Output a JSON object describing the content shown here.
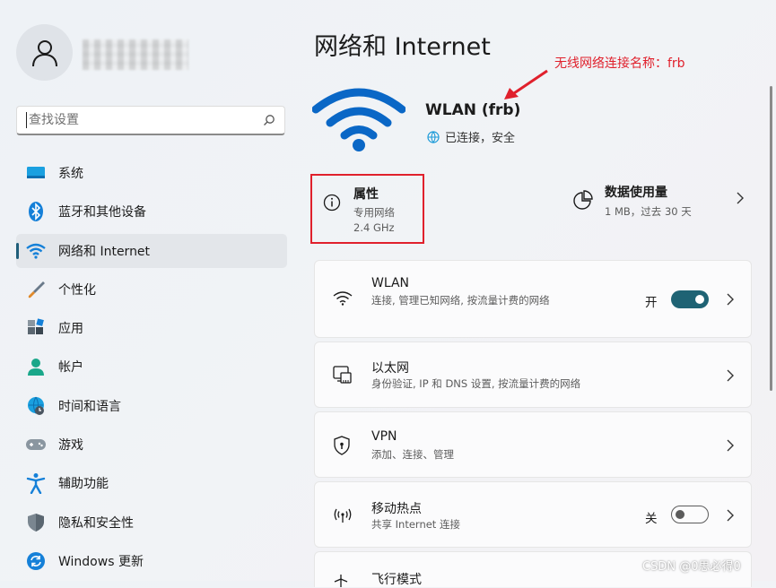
{
  "sidebar": {
    "search": {
      "placeholder": "查找设置"
    },
    "items": [
      {
        "label": "系统",
        "icon": "system-icon"
      },
      {
        "label": "蓝牙和其他设备",
        "icon": "bluetooth-icon"
      },
      {
        "label": "网络和 Internet",
        "icon": "wifi-icon",
        "active": true
      },
      {
        "label": "个性化",
        "icon": "brush-icon"
      },
      {
        "label": "应用",
        "icon": "apps-icon"
      },
      {
        "label": "帐户",
        "icon": "account-icon"
      },
      {
        "label": "时间和语言",
        "icon": "globe-clock-icon"
      },
      {
        "label": "游戏",
        "icon": "gamepad-icon"
      },
      {
        "label": "辅助功能",
        "icon": "accessibility-icon"
      },
      {
        "label": "隐私和安全性",
        "icon": "shield-icon"
      },
      {
        "label": "Windows 更新",
        "icon": "update-icon"
      }
    ]
  },
  "main": {
    "title": "网络和 Internet",
    "annotation": "无线网络连接名称：frb",
    "network": {
      "name": "WLAN (frb)",
      "status": "已连接，安全"
    },
    "properties": {
      "title": "属性",
      "type": "专用网络",
      "band": "2.4 GHz"
    },
    "data_usage": {
      "title": "数据使用量",
      "detail": "1 MB，过去 30 天"
    },
    "cards": [
      {
        "title": "WLAN",
        "subtitle": "连接, 管理已知网络, 按流量计费的网络",
        "toggle_label": "开",
        "toggle_on": true,
        "icon": "wifi-icon"
      },
      {
        "title": "以太网",
        "subtitle": "身份验证, IP 和 DNS 设置, 按流量计费的网络",
        "icon": "ethernet-icon"
      },
      {
        "title": "VPN",
        "subtitle": "添加、连接、管理",
        "icon": "vpn-shield-icon"
      },
      {
        "title": "移动热点",
        "subtitle": "共享 Internet 连接",
        "toggle_label": "关",
        "toggle_on": false,
        "icon": "hotspot-icon"
      },
      {
        "title": "飞行模式",
        "icon": "airplane-icon"
      }
    ]
  },
  "colors": {
    "accent": "#1f6374",
    "annotation_red": "#e0202c",
    "wifi_blue": "#0a67c6"
  },
  "watermark": "CSDN @0思必得0"
}
